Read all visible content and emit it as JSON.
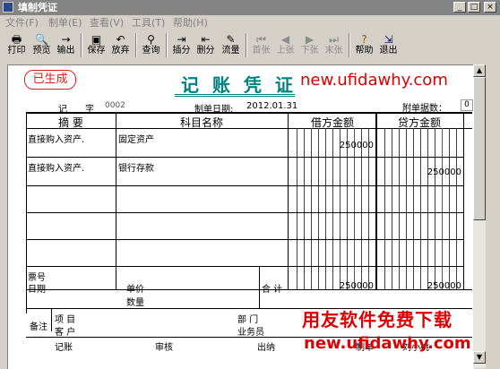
{
  "window": {
    "title": "填制凭证",
    "minimize": "_",
    "maximize": "□",
    "close": "×"
  },
  "menu": [
    "文件(F)",
    "制单(E)",
    "查看(V)",
    "工具(T)",
    "帮助(H)"
  ],
  "toolbar": {
    "print": "打印",
    "preview": "预览",
    "export": "输出",
    "save": "保存",
    "discard": "放弃",
    "query": "查询",
    "insert": "插分",
    "delete": "删分",
    "flow": "流量",
    "first": "首张",
    "prev": "上张",
    "next": "下张",
    "last": "末张",
    "help": "帮助",
    "exit": "退出"
  },
  "voucher": {
    "stamp": "已生成",
    "title": "记 账 凭 证",
    "watermark": "new.ufidawhy.com",
    "type_label": "记",
    "number_label": "字",
    "number": "0002",
    "date_label": "制单日期:",
    "date": "2012.01.31",
    "attachment_label": "附单据数：",
    "attachment_count": "0",
    "headers": {
      "summary": "摘 要",
      "account": "科目名称",
      "debit": "借方金额",
      "credit": "贷方金额"
    },
    "rows": [
      {
        "summary": "直接购入资产.",
        "account": "固定资产",
        "debit": "250000",
        "credit": ""
      },
      {
        "summary": "直接购入资产.",
        "account": "银行存款",
        "debit": "",
        "credit": "250000"
      }
    ],
    "ticket_label": "票号",
    "ticket_date_label": "日期",
    "unit_price_label": "单价",
    "quantity_label": "数量",
    "total_label": "合 计",
    "total_debit": "250000",
    "total_credit": "250000",
    "remark_label": "备注",
    "project_label": "项 目",
    "customer_label": "客 户",
    "department_label": "部 门",
    "salesperson_label": "业务员",
    "footer": {
      "bookkeeping": "记账",
      "review": "审核",
      "cashier": "出纳",
      "maker": "制单",
      "maker_name": "刘小桃"
    },
    "big_watermark": "用友软件免费下载",
    "big_watermark_url": "new.ufidawhy.com"
  },
  "colors": {
    "stamp_red": "#e02020",
    "title_teal": "#008080",
    "watermark_red": "#dd0000",
    "ruling_blue": "#3030c0",
    "ruling_red": "#e02020"
  }
}
